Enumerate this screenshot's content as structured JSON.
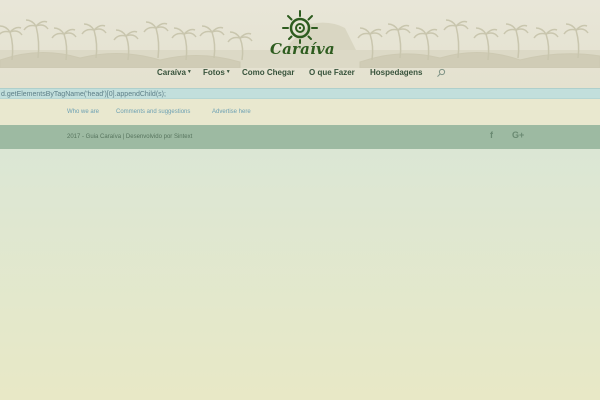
{
  "brand": {
    "name": "Caraíva"
  },
  "nav": {
    "items": [
      {
        "label": "Caraíva",
        "has_dropdown": true
      },
      {
        "label": "Fotos",
        "has_dropdown": true
      },
      {
        "label": "Como Chegar",
        "has_dropdown": false
      },
      {
        "label": "O que Fazer",
        "has_dropdown": false
      },
      {
        "label": "Hospedagens",
        "has_dropdown": false
      }
    ],
    "search_icon": "search-icon"
  },
  "code_leak": "d.getElementsByTagName('head')[0].appendChild(s);",
  "footer_links": [
    {
      "label": "Who we are"
    },
    {
      "label": "Comments and suggestions"
    },
    {
      "label": "Advertise here"
    }
  ],
  "footer": {
    "copyright": "2017 - Guia Caraíva | Desenvolvido por",
    "credit": "Sintext",
    "social": [
      {
        "icon": "facebook-icon",
        "glyph": "f"
      },
      {
        "icon": "google-plus-icon",
        "glyph": "G+"
      }
    ]
  },
  "colors": {
    "nav_text": "#37533b",
    "logo_green": "#2e5c1f",
    "link": "#6ca0b3",
    "footer_bar": "#9dbaa2",
    "code_strip": "#c2dfdc"
  }
}
